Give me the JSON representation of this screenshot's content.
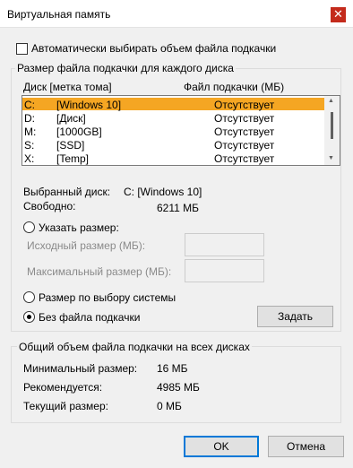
{
  "window": {
    "title": "Виртуальная память",
    "close_glyph": "✕"
  },
  "auto_manage": {
    "label": "Автоматически выбирать объем файла подкачки",
    "checked": false
  },
  "per_drive_group": {
    "title": "Размер файла подкачки для каждого диска",
    "col_drive": "Диск [метка тома]",
    "col_paging": "Файл подкачки (МБ)",
    "drives": [
      {
        "letter": "C:",
        "label": "[Windows 10]",
        "paging": "Отсутствует",
        "selected": true
      },
      {
        "letter": "D:",
        "label": "[Диск]",
        "paging": "Отсутствует",
        "selected": false
      },
      {
        "letter": "M:",
        "label": "[1000GB]",
        "paging": "Отсутствует",
        "selected": false
      },
      {
        "letter": "S:",
        "label": "[SSD]",
        "paging": "Отсутствует",
        "selected": false
      },
      {
        "letter": "X:",
        "label": "[Temp]",
        "paging": "Отсутствует",
        "selected": false
      }
    ],
    "selected_drive_label": "Выбранный диск:",
    "selected_drive_value": "C:  [Windows 10]",
    "free_label": "Свободно:",
    "free_value": "6211 МБ",
    "custom_size": {
      "label": "Указать размер:",
      "initial_label": "Исходный размер (МБ):",
      "initial_value": "",
      "max_label": "Максимальный размер (МБ):",
      "max_value": ""
    },
    "system_managed_label": "Размер по выбору системы",
    "no_paging_label": "Без файла подкачки",
    "selected_option": "no_paging",
    "set_button": "Задать"
  },
  "totals_group": {
    "title": "Общий объем файла подкачки на всех дисках",
    "min_label": "Минимальный размер:",
    "min_value": "16 МБ",
    "recommended_label": "Рекомендуется:",
    "recommended_value": "4985 МБ",
    "current_label": "Текущий размер:",
    "current_value": "0 МБ"
  },
  "buttons": {
    "ok": "OK",
    "cancel": "Отмена"
  }
}
